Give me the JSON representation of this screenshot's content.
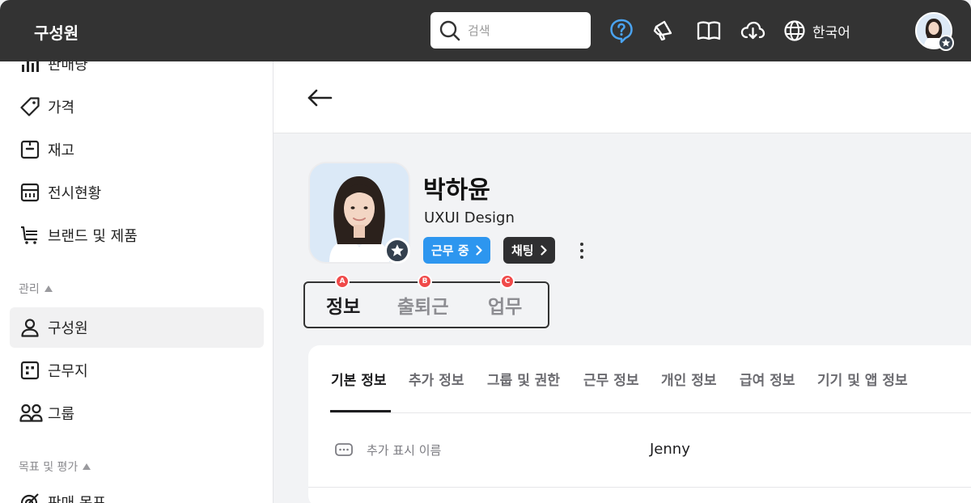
{
  "topbar": {
    "app_title": "구성원",
    "search_placeholder": "검색",
    "language": "한국어"
  },
  "sidebar": {
    "partial_top_label": "판매량",
    "items_top": [
      {
        "label": "가격",
        "icon": "tag-icon"
      },
      {
        "label": "재고",
        "icon": "box-icon"
      },
      {
        "label": "전시현황",
        "icon": "display-icon"
      },
      {
        "label": "브랜드 및 제품",
        "icon": "cart-icon"
      }
    ],
    "section_manage": "관리",
    "items_manage": [
      {
        "label": "구성원",
        "icon": "person-icon",
        "active": true
      },
      {
        "label": "근무지",
        "icon": "building-icon"
      },
      {
        "label": "그룹",
        "icon": "group-icon"
      }
    ],
    "section_goal": "목표 및 평가",
    "partial_bottom_label": "판매 목표"
  },
  "profile": {
    "name": "박하윤",
    "department": "UXUI Design",
    "status_chip": "근무 중",
    "chat_chip": "채팅"
  },
  "main_tabs": [
    {
      "label": "정보",
      "marker": "A",
      "active": true
    },
    {
      "label": "출퇴근",
      "marker": "B",
      "active": false
    },
    {
      "label": "업무",
      "marker": "C",
      "active": false
    }
  ],
  "sub_tabs": [
    "기본 정보",
    "추가 정보",
    "그룹 및 권한",
    "근무 정보",
    "개인 정보",
    "급여 정보",
    "기기 및 앱 정보"
  ],
  "fields": [
    {
      "label": "추가 표시 이름",
      "value": "Jenny"
    }
  ],
  "colors": {
    "topbar": "#333333",
    "accent_blue": "#2d96ef",
    "help_icon": "#4aa3f0",
    "marker_red": "#f04a4a"
  }
}
